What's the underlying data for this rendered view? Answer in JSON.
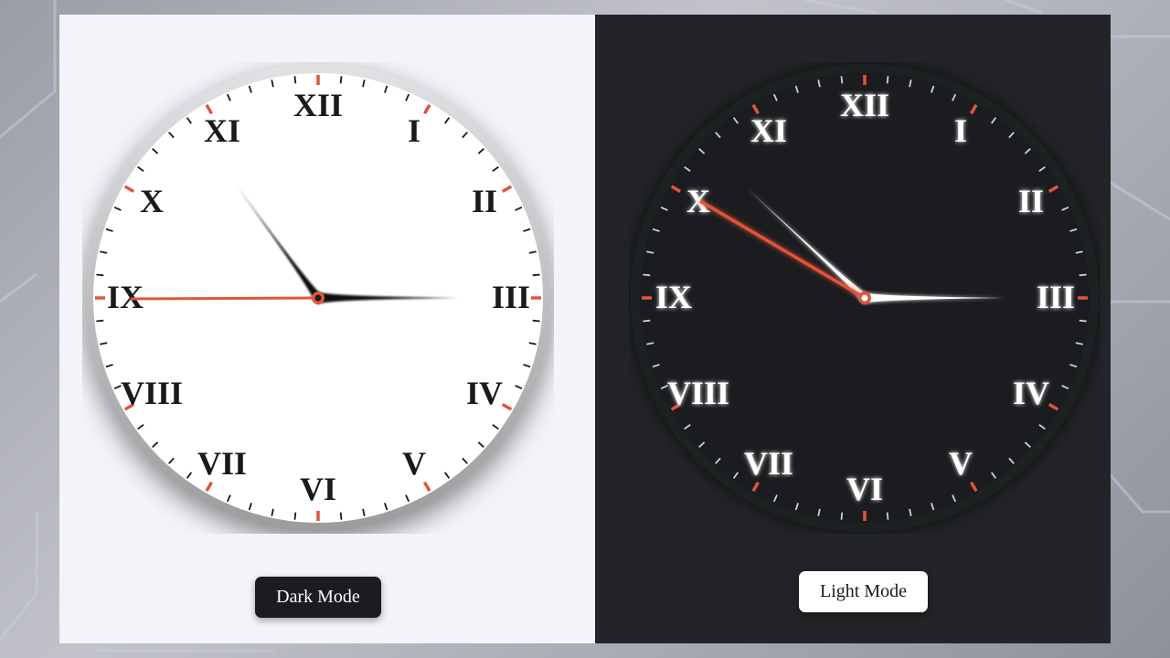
{
  "light_clock": {
    "numerals": [
      "XII",
      "I",
      "II",
      "III",
      "IV",
      "V",
      "VI",
      "VII",
      "VIII",
      "IX",
      "X",
      "XI"
    ],
    "button_label": "Dark Mode"
  },
  "dark_clock": {
    "numerals": [
      "XII",
      "I",
      "II",
      "III",
      "IV",
      "V",
      "VI",
      "VII",
      "VIII",
      "IX",
      "X",
      "XI"
    ],
    "button_label": "Light Mode"
  },
  "colors": {
    "accent": "#e0553a",
    "light_face": "#ffffff",
    "dark_face": "#1b1c1f",
    "light_text": "#1a1a1a",
    "dark_text": "#ffffff"
  }
}
